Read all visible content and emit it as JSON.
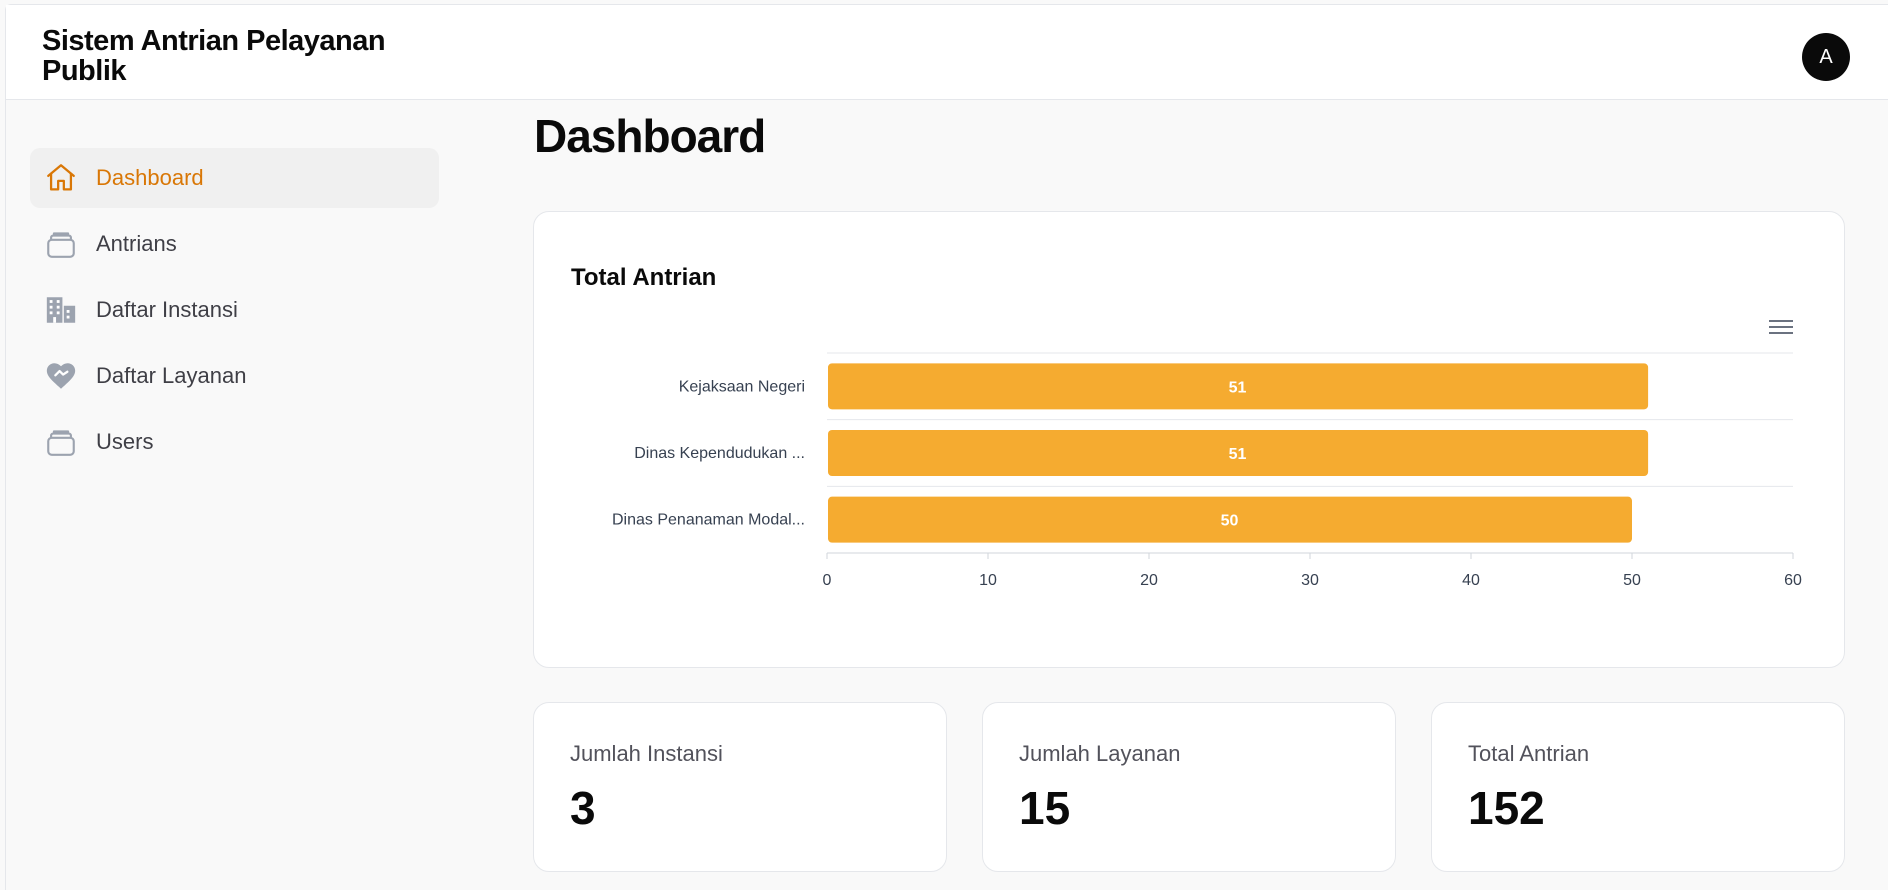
{
  "app": {
    "title": "Sistem Antrian Pelayanan Publik",
    "avatar_initial": "A"
  },
  "sidebar": {
    "items": [
      {
        "label": "Dashboard",
        "icon": "home-icon",
        "active": true
      },
      {
        "label": "Antrians",
        "icon": "stack-icon",
        "active": false
      },
      {
        "label": "Daftar Instansi",
        "icon": "building-icon",
        "active": false
      },
      {
        "label": "Daftar Layanan",
        "icon": "heart-hand-icon",
        "active": false
      },
      {
        "label": "Users",
        "icon": "stack-icon",
        "active": false
      }
    ]
  },
  "main": {
    "title": "Dashboard",
    "chart_card": {
      "title": "Total Antrian",
      "menu_icon": "hamburger-menu-icon"
    },
    "stats": [
      {
        "label": "Jumlah Instansi",
        "value": "3"
      },
      {
        "label": "Jumlah Layanan",
        "value": "15"
      },
      {
        "label": "Total Antrian",
        "value": "152"
      }
    ]
  },
  "colors": {
    "accent": "#d97706",
    "bar": "#f5ab30",
    "active_bg": "#f0f0f0"
  },
  "chart_data": {
    "type": "bar",
    "orientation": "horizontal",
    "title": "Total Antrian",
    "categories": [
      "Kejaksaan Negeri",
      "Dinas Kependudukan ...",
      "Dinas Penanaman Modal..."
    ],
    "values": [
      51,
      51,
      50
    ],
    "data_labels": [
      "51",
      "51",
      "50"
    ],
    "xlim": [
      0,
      60
    ],
    "xticks": [
      0,
      10,
      20,
      30,
      40,
      50,
      60
    ],
    "grid": "horizontal category separators",
    "legend": "none"
  }
}
